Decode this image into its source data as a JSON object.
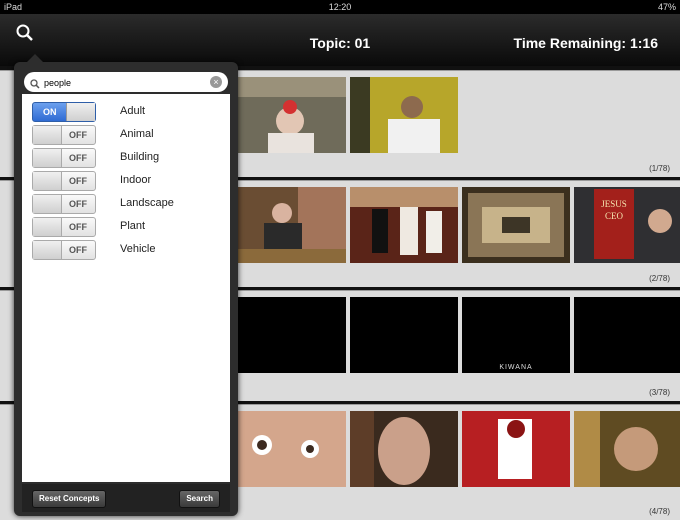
{
  "status_bar": {
    "device": "iPad",
    "time": "12:20",
    "battery": "47%"
  },
  "nav_bar": {
    "topic": "Topic: 01",
    "time_remaining": "Time Remaining: 1:16"
  },
  "popover": {
    "search": {
      "value": "people"
    },
    "concepts": [
      {
        "label": "Adult",
        "state": "ON"
      },
      {
        "label": "Animal",
        "state": "OFF"
      },
      {
        "label": "Building",
        "state": "OFF"
      },
      {
        "label": "Indoor",
        "state": "OFF"
      },
      {
        "label": "Landscape",
        "state": "OFF"
      },
      {
        "label": "Plant",
        "state": "OFF"
      },
      {
        "label": "Vehicle",
        "state": "OFF"
      }
    ],
    "reset_button": "Reset Concepts",
    "search_button": "Search"
  },
  "results": {
    "rows": [
      {
        "count": "(1/78)"
      },
      {
        "count": "(2/78)"
      },
      {
        "count": "(3/78)",
        "frame_caption": "KIWANA"
      },
      {
        "count": "(4/78)"
      }
    ]
  }
}
